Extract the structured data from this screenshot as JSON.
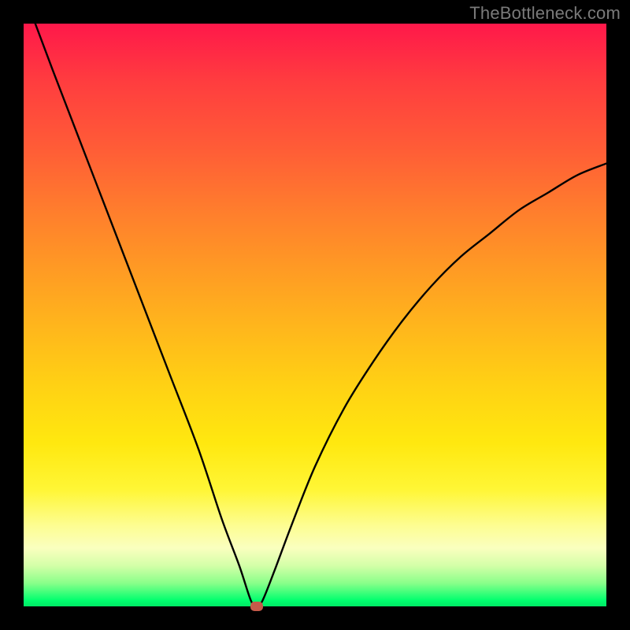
{
  "watermark": "TheBottleneck.com",
  "colors": {
    "frame": "#000000",
    "curve": "#000000",
    "marker": "#c65a4a"
  },
  "chart_data": {
    "type": "line",
    "title": "",
    "xlabel": "",
    "ylabel": "",
    "xlim": [
      0,
      100
    ],
    "ylim": [
      0,
      100
    ],
    "grid": false,
    "legend": false,
    "marker": {
      "x": 40,
      "y": 0
    },
    "x": [
      2,
      5,
      10,
      15,
      20,
      25,
      30,
      34,
      37,
      39,
      40,
      41,
      43,
      46,
      50,
      55,
      60,
      65,
      70,
      75,
      80,
      85,
      90,
      95,
      100
    ],
    "values": [
      100,
      92,
      79,
      66,
      53,
      40,
      27,
      15,
      7,
      1,
      0,
      1,
      6,
      14,
      24,
      34,
      42,
      49,
      55,
      60,
      64,
      68,
      71,
      74,
      76
    ]
  }
}
